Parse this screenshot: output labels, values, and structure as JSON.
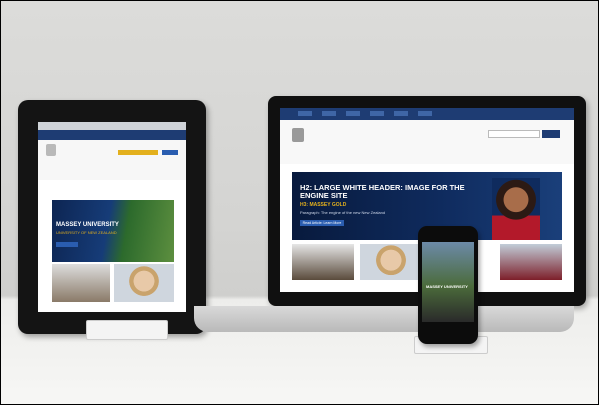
{
  "scene": {
    "description_colors": {
      "navy": "#1e3c73",
      "gold": "#e3b01d",
      "device_black": "#101010"
    }
  },
  "laptop": {
    "hero_title": "H2: LARGE WHITE HEADER: IMAGE FOR THE ENGINE SITE",
    "hero_subtitle": "H3: MASSEY GOLD",
    "hero_paragraph": "Paragraph: The engine of the new New Zealand",
    "hero_button": "Read Article: Learn More"
  },
  "tablet": {
    "hero_title": "MASSEY UNIVERSITY",
    "hero_subtitle": "UNIVERSITY OF NEW ZEALAND"
  },
  "phone": {
    "hero_title": "MASSEY UNIVERSITY"
  }
}
